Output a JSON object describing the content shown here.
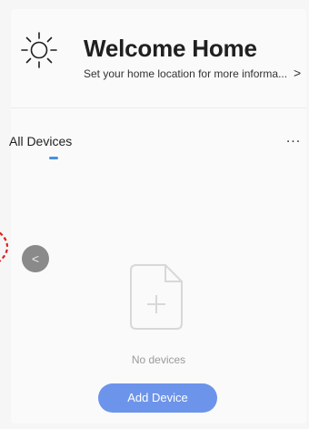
{
  "header": {
    "title": "Welcome Home",
    "subtitle": "Set your home location for more informa...",
    "chevron": ">",
    "icon": "sun-icon"
  },
  "tabs": [
    {
      "label": "All Devices",
      "active": true
    }
  ],
  "more_button": "...",
  "collapse_button": "<",
  "empty_state": {
    "icon": "add-file-icon",
    "text": "No devices"
  },
  "add_device_button": "Add Device",
  "colors": {
    "accent": "#6c94ea",
    "tab_indicator": "#4a90e2",
    "collapse_handle": "#e02020"
  }
}
